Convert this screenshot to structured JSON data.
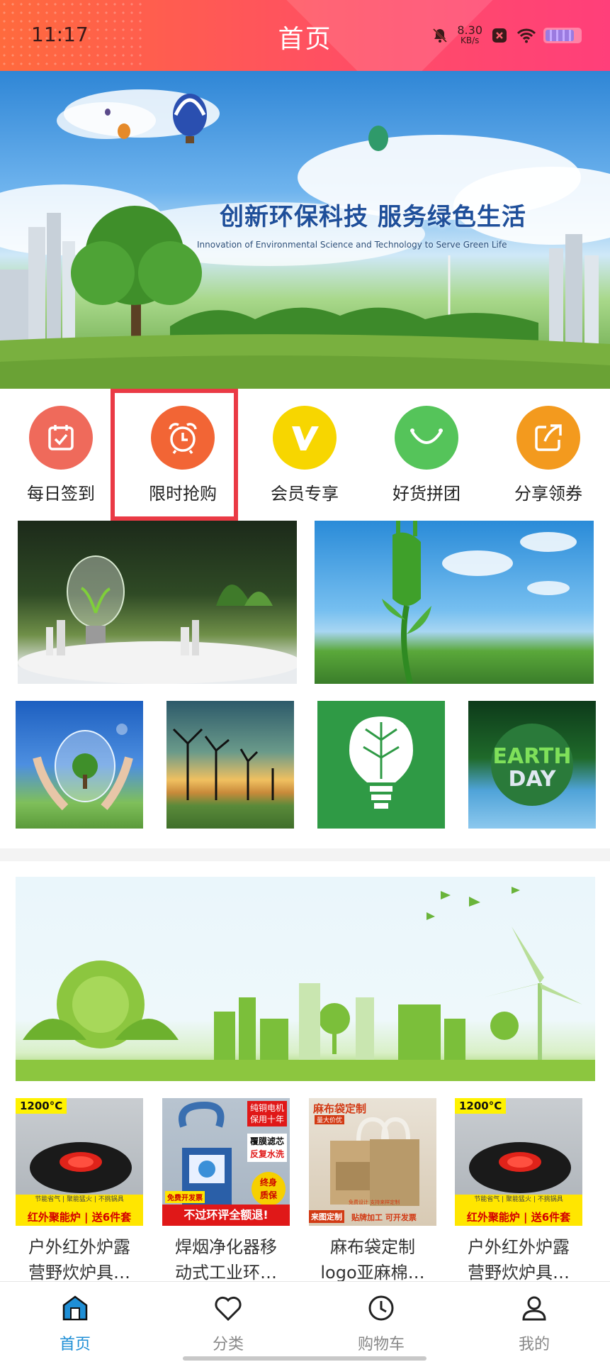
{
  "status_bar": {
    "time": "11:17",
    "net_speed_value": "8.30",
    "net_speed_unit": "KB/s",
    "icons": [
      "bell-muted-icon",
      "close-badge-icon",
      "wifi-icon",
      "battery-icon"
    ]
  },
  "header": {
    "title": "首页",
    "color_start": "#ff6a3d",
    "color_end": "#ff3f7a"
  },
  "hero_banner": {
    "title": "创新环保科技  服务绿色生活",
    "subtitle": "Innovation of Environmental Science and Technology to Serve Green Life"
  },
  "quick_nav": [
    {
      "label": "每日签到",
      "icon": "calendar-check-icon",
      "color": "#ef6a5b"
    },
    {
      "label": "限时抢购",
      "icon": "alarm-clock-icon",
      "color": "#f26535",
      "highlighted": true
    },
    {
      "label": "会员专享",
      "icon": "v-badge-icon",
      "color": "#f7d600"
    },
    {
      "label": "好货拼团",
      "icon": "smile-basket-icon",
      "color": "#55c45a"
    },
    {
      "label": "分享领券",
      "icon": "share-icon",
      "color": "#f39a1e"
    }
  ],
  "products": [
    {
      "name_line1": "户外红外炉露",
      "name_line2": "营野炊炉具…",
      "badge": "1200°C",
      "strip_small": "节能省气 | 聚能猛火 | 不挑锅具",
      "strip": "红外聚能炉 | 送6件套"
    },
    {
      "name_line1": "焊烟净化器移",
      "name_line2": "动式工业环…",
      "tag1": "纯铜电机",
      "tag1b": "保用十年",
      "tag2": "覆膜滤芯",
      "tag2b": "反复水洗",
      "tag3": "终身",
      "tag3b": "质保",
      "tag4": "免费开发票",
      "strip": "不过环评全额退!"
    },
    {
      "name_line1": "麻布袋定制",
      "name_line2": "logo亚麻棉…",
      "tag1": "麻布袋定制",
      "tag1b": "量大价优",
      "tag2": "来图定制",
      "tag3": "贴牌加工 可开发票",
      "tag4": "免费设计 支持来样定制"
    },
    {
      "name_line1": "户外红外炉露",
      "name_line2": "营野炊炉具…",
      "badge": "1200°C",
      "strip_small": "节能省气 | 聚能猛火 | 不挑锅具",
      "strip": "红外聚能炉 | 送6件套"
    }
  ],
  "tab_bar": [
    {
      "label": "首页",
      "icon": "home-icon",
      "active": true
    },
    {
      "label": "分类",
      "icon": "heart-icon",
      "active": false
    },
    {
      "label": "购物车",
      "icon": "clock-icon",
      "active": false
    },
    {
      "label": "我的",
      "icon": "user-icon",
      "active": false
    }
  ],
  "colors": {
    "accent": "#1f8fd6",
    "highlight_border": "#ea3a45"
  }
}
